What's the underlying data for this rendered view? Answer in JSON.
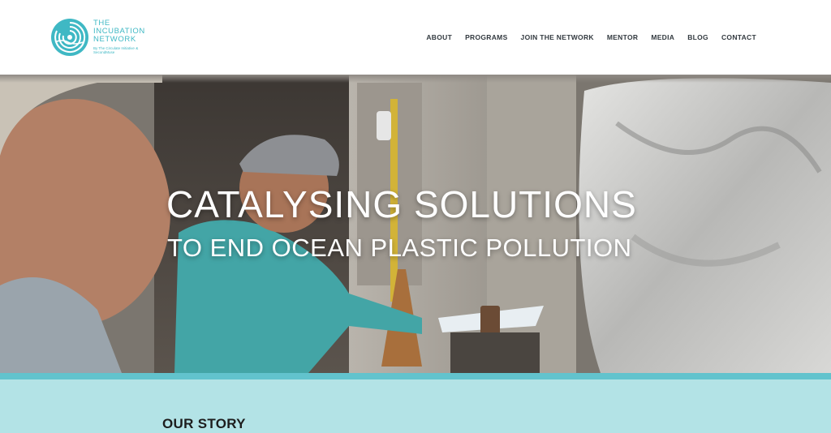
{
  "brand": {
    "name_lines": [
      "THE",
      "INCUBATION",
      "NETWORK"
    ],
    "tagline": "By The Circulate Initiative & SecondMuse",
    "color": "#3fb8c4"
  },
  "nav": {
    "items": [
      "ABOUT",
      "PROGRAMS",
      "JOIN THE NETWORK",
      "MENTOR",
      "MEDIA",
      "BLOG",
      "CONTACT"
    ]
  },
  "hero": {
    "heading": "CATALYSING SOLUTIONS",
    "subheading": "TO END OCEAN PLASTIC POLLUTION"
  },
  "story": {
    "title": "OUR STORY",
    "band_color": "#b3e3e6",
    "strip_color": "#62c3cd"
  }
}
